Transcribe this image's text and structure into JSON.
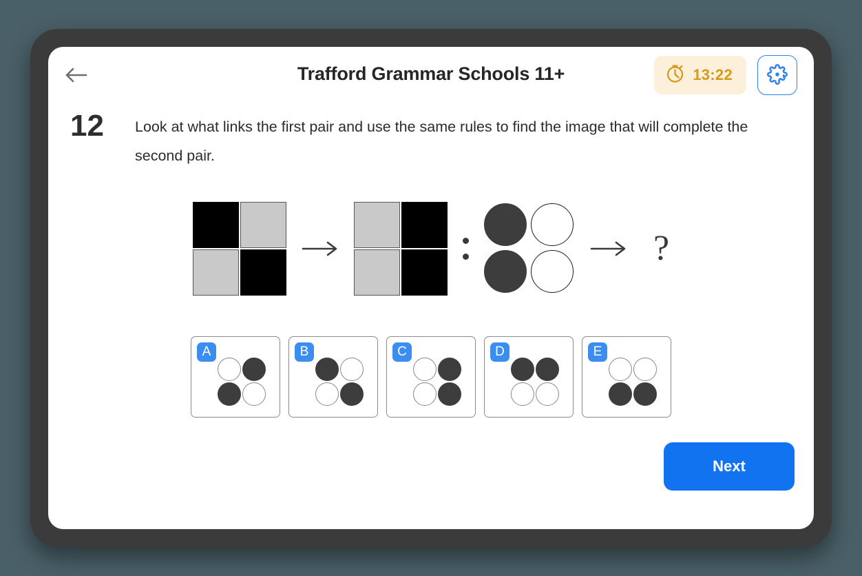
{
  "app": {
    "title": "Trafford Grammar Schools 11+",
    "background_color": "#4a6068",
    "accent_color": "#1273f0"
  },
  "header": {
    "back_icon": "arrow-left-icon",
    "timer": {
      "icon": "stopwatch-icon",
      "value": "13:22",
      "text_color": "#d69a18",
      "background_color": "#fdf0da"
    },
    "settings": {
      "icon": "gear-icon",
      "color": "#2f80ed"
    }
  },
  "question": {
    "number": "12",
    "text": "Look at what links the first pair and use the same rules to find the image that will complete the second pair.",
    "stimulus": {
      "pair_one": {
        "figure_a": {
          "shape": "square",
          "cells": [
            "black",
            "gray",
            "gray",
            "black"
          ]
        },
        "transform_icon": "arrow-right-icon",
        "figure_b": {
          "shape": "square",
          "cells": [
            "gray",
            "black",
            "gray",
            "black"
          ]
        }
      },
      "separator": "colon",
      "pair_two": {
        "figure_c": {
          "shape": "circle",
          "cells": [
            "dark",
            "white",
            "dark",
            "white"
          ]
        },
        "transform_icon": "arrow-right-icon",
        "figure_d": {
          "shape": "unknown",
          "label": "?"
        }
      }
    },
    "options": [
      {
        "letter": "A",
        "cells": [
          "white",
          "dark",
          "dark",
          "white"
        ]
      },
      {
        "letter": "B",
        "cells": [
          "dark",
          "white",
          "white",
          "dark"
        ]
      },
      {
        "letter": "C",
        "cells": [
          "white",
          "dark",
          "white",
          "dark"
        ]
      },
      {
        "letter": "D",
        "cells": [
          "dark",
          "dark",
          "white",
          "white"
        ]
      },
      {
        "letter": "E",
        "cells": [
          "white",
          "white",
          "dark",
          "dark"
        ]
      }
    ]
  },
  "footer": {
    "next_label": "Next"
  }
}
